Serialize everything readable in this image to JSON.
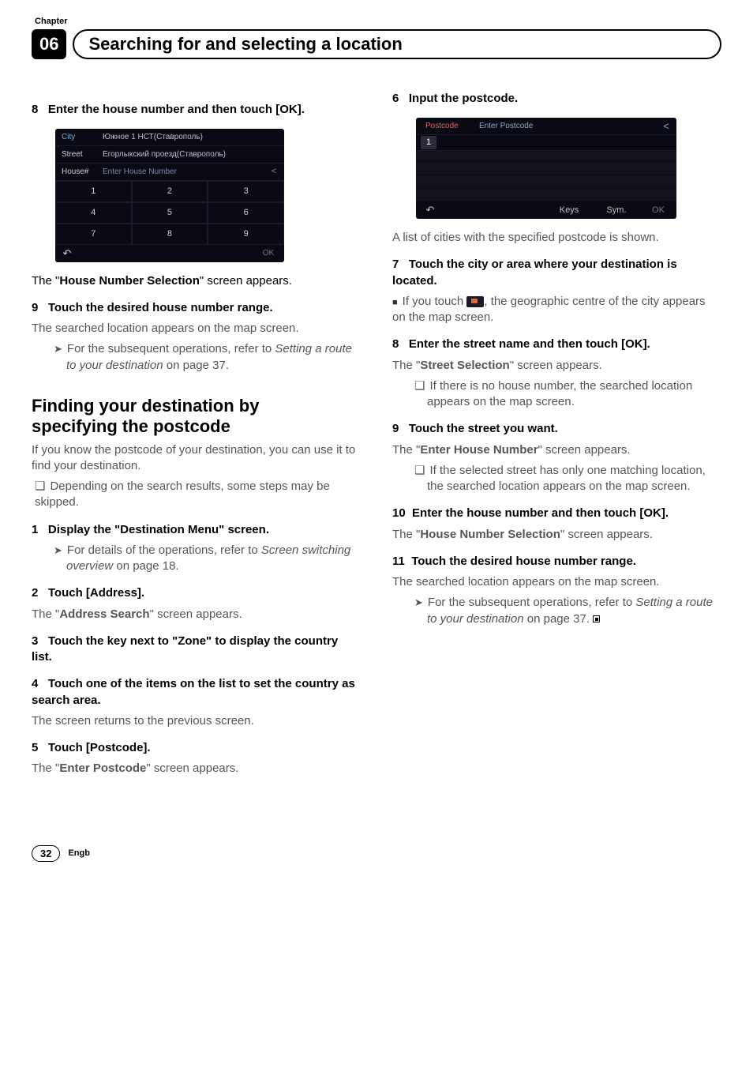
{
  "chapter": {
    "label": "Chapter",
    "number": "06"
  },
  "header": {
    "title": "Searching for and selecting a location"
  },
  "left": {
    "s8": {
      "num": "8",
      "text": "Enter the house number and then touch [OK]."
    },
    "ss1": {
      "city_label": "City",
      "city_val": "Южное 1 НСТ(Ставрополь)",
      "street_label": "Street",
      "street_val": "Егорлыкский проезд(Ставрополь)",
      "house_label": "House#",
      "house_val": "Enter House Number",
      "back_glyph": "<",
      "nums": [
        "1",
        "2",
        "3",
        "4",
        "5",
        "6",
        "7",
        "8",
        "9"
      ],
      "back_icon": "↶",
      "ok": "OK"
    },
    "after_ss1_a": "The \"",
    "after_ss1_b": "House Number Selection",
    "after_ss1_c": "\" screen appears.",
    "s9": {
      "num": "9",
      "text": "Touch the desired house number range."
    },
    "s9_p": "The searched location appears on the map screen.",
    "s9_ref_a": "For the subsequent operations, refer to ",
    "s9_ref_b": "Setting a route to your destination",
    "s9_ref_c": " on page 37.",
    "h2a": "Finding your destination by",
    "h2b": "specifying the postcode",
    "h2_p": "If you know the postcode of your destination, you can use it to find your destination.",
    "h2_box": "Depending on the search results, some steps may be skipped.",
    "s1": {
      "num": "1",
      "text": "Display the \"Destination Menu\" screen."
    },
    "s1_ref_a": "For details of the operations, refer to ",
    "s1_ref_b": "Screen switching overview",
    "s1_ref_c": " on page 18.",
    "s2": {
      "num": "2",
      "text": "Touch [Address]."
    },
    "s2_p_a": "The \"",
    "s2_p_b": "Address Search",
    "s2_p_c": "\" screen appears.",
    "s3": {
      "num": "3",
      "text": "Touch the key next to \"Zone\" to display the country list."
    },
    "s4": {
      "num": "4",
      "text": "Touch one of the items on the list to set the country as search area."
    },
    "s4_p": "The screen returns to the previous screen.",
    "s5": {
      "num": "5",
      "text": "Touch [Postcode]."
    },
    "s5_p_a": "The \"",
    "s5_p_b": "Enter Postcode",
    "s5_p_c": "\" screen appears."
  },
  "right": {
    "s6": {
      "num": "6",
      "text": "Input the postcode."
    },
    "ss2": {
      "pc": "Postcode",
      "ep": "Enter Postcode",
      "back": "<",
      "one": "1",
      "back_icon": "↶",
      "keys": "Keys",
      "sym": "Sym.",
      "ok": "OK"
    },
    "s6_p": "A list of cities with the specified postcode is shown.",
    "s7": {
      "num": "7",
      "text": "Touch the city or area where your destination is located."
    },
    "s7_b_a": "If you touch ",
    "s7_b_c": ", the geographic centre of the city appears on the map screen.",
    "s8": {
      "num": "8",
      "text": "Enter the street name and then touch [OK]."
    },
    "s8_p_a": "The \"",
    "s8_p_b": "Street Selection",
    "s8_p_c": "\" screen appears.",
    "s8_box": "If there is no house number, the searched location appears on the map screen.",
    "s9": {
      "num": "9",
      "text": "Touch the street you want."
    },
    "s9_p_a": "The \"",
    "s9_p_b": "Enter House Number",
    "s9_p_c": "\" screen appears.",
    "s9_box": "If the selected street has only one matching location, the searched location appears on the map screen.",
    "s10": {
      "num": "10",
      "text": "Enter the house number and then touch [OK]."
    },
    "s10_p_a": "The \"",
    "s10_p_b": "House Number Selection",
    "s10_p_c": "\" screen appears.",
    "s11": {
      "num": "11",
      "text": "Touch the desired house number range."
    },
    "s11_p": "The searched location appears on the map screen.",
    "s11_ref_a": "For the subsequent operations, refer to ",
    "s11_ref_b": "Setting a route to your destination",
    "s11_ref_c": " on page 37."
  },
  "footer": {
    "page": "32",
    "lang": "Engb"
  }
}
